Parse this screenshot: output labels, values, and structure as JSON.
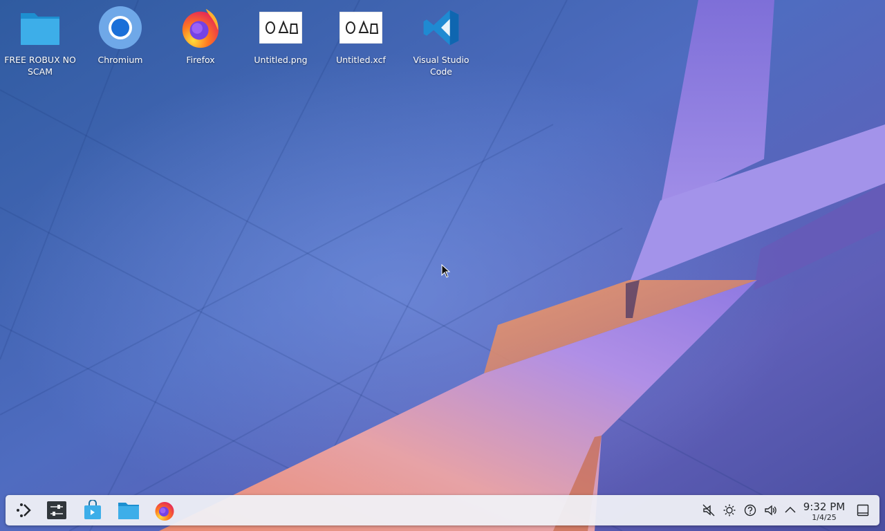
{
  "desktop": {
    "icons": [
      {
        "label": "FREE ROBUX NO SCAM",
        "icon": "folder-icon"
      },
      {
        "label": "Chromium",
        "icon": "chromium-icon"
      },
      {
        "label": "Firefox",
        "icon": "firefox-icon"
      },
      {
        "label": "Untitled.png",
        "icon": "image-icon"
      },
      {
        "label": "Untitled.xcf",
        "icon": "image-icon"
      },
      {
        "label": "Visual Studio Code",
        "icon": "vscode-icon"
      }
    ]
  },
  "taskbar": {
    "launchers": [
      {
        "icon": "app-launcher-icon"
      },
      {
        "icon": "system-settings-icon"
      },
      {
        "icon": "discover-store-icon"
      },
      {
        "icon": "file-manager-icon"
      },
      {
        "icon": "firefox-icon"
      }
    ],
    "tray": [
      {
        "icon": "muted-speaker-icon"
      },
      {
        "icon": "brightness-icon"
      },
      {
        "icon": "help-icon"
      },
      {
        "icon": "volume-icon"
      },
      {
        "icon": "chevron-up-icon"
      }
    ],
    "clock": {
      "time": "9:32 PM",
      "date": "1/4/25"
    },
    "show_desktop_icon": "show-desktop-icon"
  },
  "colors": {
    "wallpaper_blue": "#3f5aa6",
    "ribbon_purple": "#8d74e0",
    "ribbon_orange": "#f0a070",
    "panel": "#f0f1f6"
  }
}
